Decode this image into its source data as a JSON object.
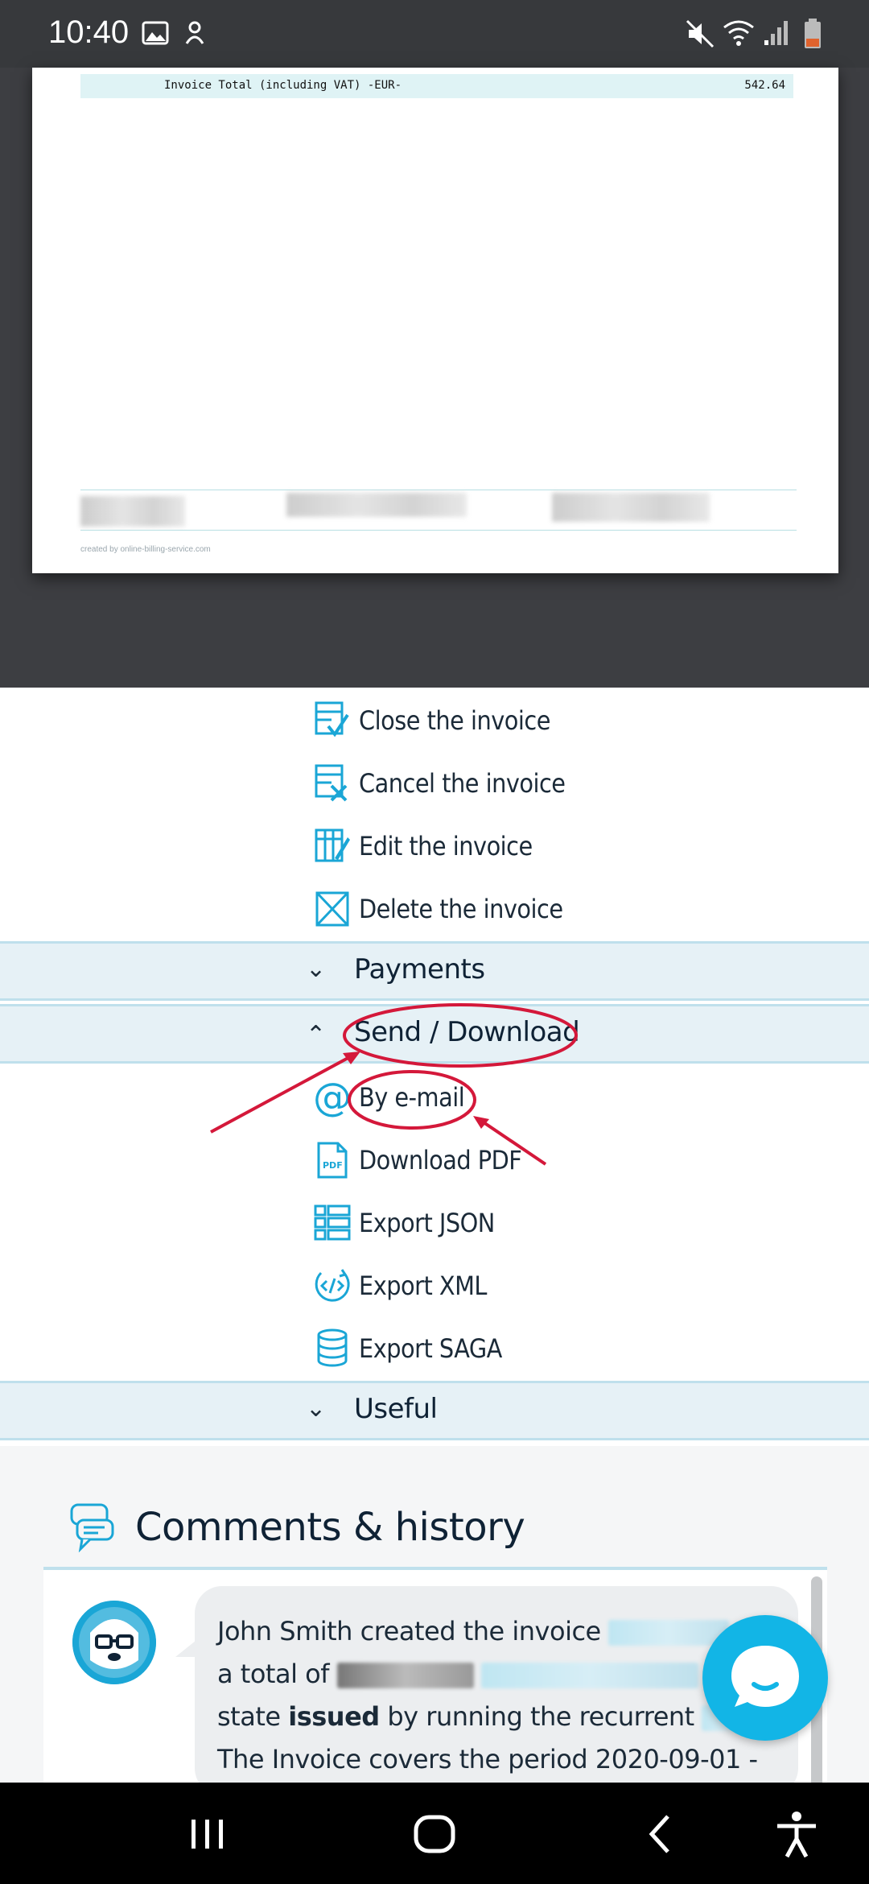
{
  "status_bar": {
    "time": "10:40",
    "left_icons": [
      "image-icon",
      "notification-icon"
    ],
    "right_icons": [
      "mute-icon",
      "wifi-icon",
      "signal-icon",
      "battery-icon"
    ]
  },
  "invoice_preview": {
    "total_label": "Invoice Total (including VAT) -EUR-",
    "total_value": "542.64",
    "created_by": "created by online-billing-service.com"
  },
  "actions_menu": [
    {
      "label": "Close the invoice",
      "icon": "close-invoice-icon"
    },
    {
      "label": "Cancel the invoice",
      "icon": "cancel-invoice-icon"
    },
    {
      "label": "Edit the invoice",
      "icon": "edit-invoice-icon"
    },
    {
      "label": "Delete the invoice",
      "icon": "delete-invoice-icon"
    }
  ],
  "sections": {
    "payments": {
      "label": "Payments",
      "expanded": false
    },
    "send_download": {
      "label": "Send / Download",
      "expanded": true
    },
    "useful": {
      "label": "Useful",
      "expanded": false
    }
  },
  "send_download_items": [
    {
      "label": "By e-mail",
      "icon": "at-icon"
    },
    {
      "label": "Download PDF",
      "icon": "pdf-icon"
    },
    {
      "label": "Export JSON",
      "icon": "json-icon"
    },
    {
      "label": "Export XML",
      "icon": "xml-icon"
    },
    {
      "label": "Export SAGA",
      "icon": "saga-icon"
    }
  ],
  "comments": {
    "title": "Comments & history",
    "entry": {
      "line1": "John Smith created the invoice",
      "line2": "a total of",
      "line3_pre": "state",
      "line3_bold": "issued",
      "line3_post": "by running the recurrent",
      "line4": "The Invoice covers the period 2020-09-01 -"
    }
  },
  "colors": {
    "accent": "#12b5e6",
    "section_bg": "#e6f1f6",
    "annotation_red": "#d4183a",
    "text": "#0f2235"
  }
}
